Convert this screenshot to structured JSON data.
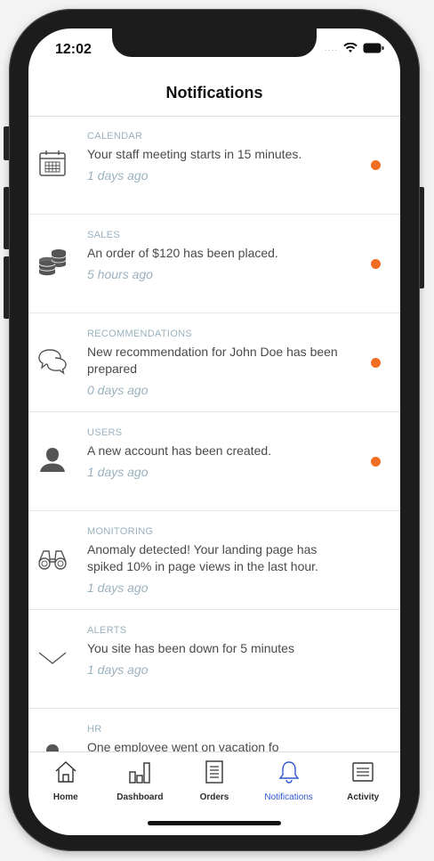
{
  "status_bar": {
    "time": "12:02",
    "signal": "....",
    "wifi_icon": "wifi-icon",
    "battery_icon": "battery-icon"
  },
  "header": {
    "title": "Notifications"
  },
  "notifications": [
    {
      "category": "CALENDAR",
      "message": "Your staff meeting starts in 15 minutes.",
      "ago": "1 days ago",
      "icon": "calendar-icon",
      "unread": true
    },
    {
      "category": "SALES",
      "message": "An order of $120 has been placed.",
      "ago": "5 hours ago",
      "icon": "coins-icon",
      "unread": true
    },
    {
      "category": "RECOMMENDATIONS",
      "message": "New recommendation for John Doe has been prepared",
      "ago": "0 days ago",
      "icon": "chat-bubbles-icon",
      "unread": true
    },
    {
      "category": "USERS",
      "message": "A new account has been created.",
      "ago": "1 days ago",
      "icon": "user-icon",
      "unread": true
    },
    {
      "category": "MONITORING",
      "message": "Anomaly detected! Your landing page has spiked 10% in page views in the last hour.",
      "ago": "1 days ago",
      "icon": "binoculars-icon",
      "unread": false
    },
    {
      "category": "ALERTS",
      "message": "You site has been down for 5 minutes",
      "ago": "1 days ago",
      "icon": "chevron-down-icon",
      "unread": false
    },
    {
      "category": "HR",
      "message": "One employee went on vacation fo",
      "ago": "",
      "icon": "user-icon",
      "unread": false
    }
  ],
  "tabs": [
    {
      "label": "Home",
      "icon": "home-icon"
    },
    {
      "label": "Dashboard",
      "icon": "bar-chart-icon"
    },
    {
      "label": "Orders",
      "icon": "document-icon"
    },
    {
      "label": "Notifications",
      "icon": "bell-icon",
      "active": true
    },
    {
      "label": "Activity",
      "icon": "list-icon"
    }
  ],
  "colors": {
    "accent": "#2f56d0",
    "unread_dot": "#f06d23",
    "muted": "#9ab2bf"
  }
}
